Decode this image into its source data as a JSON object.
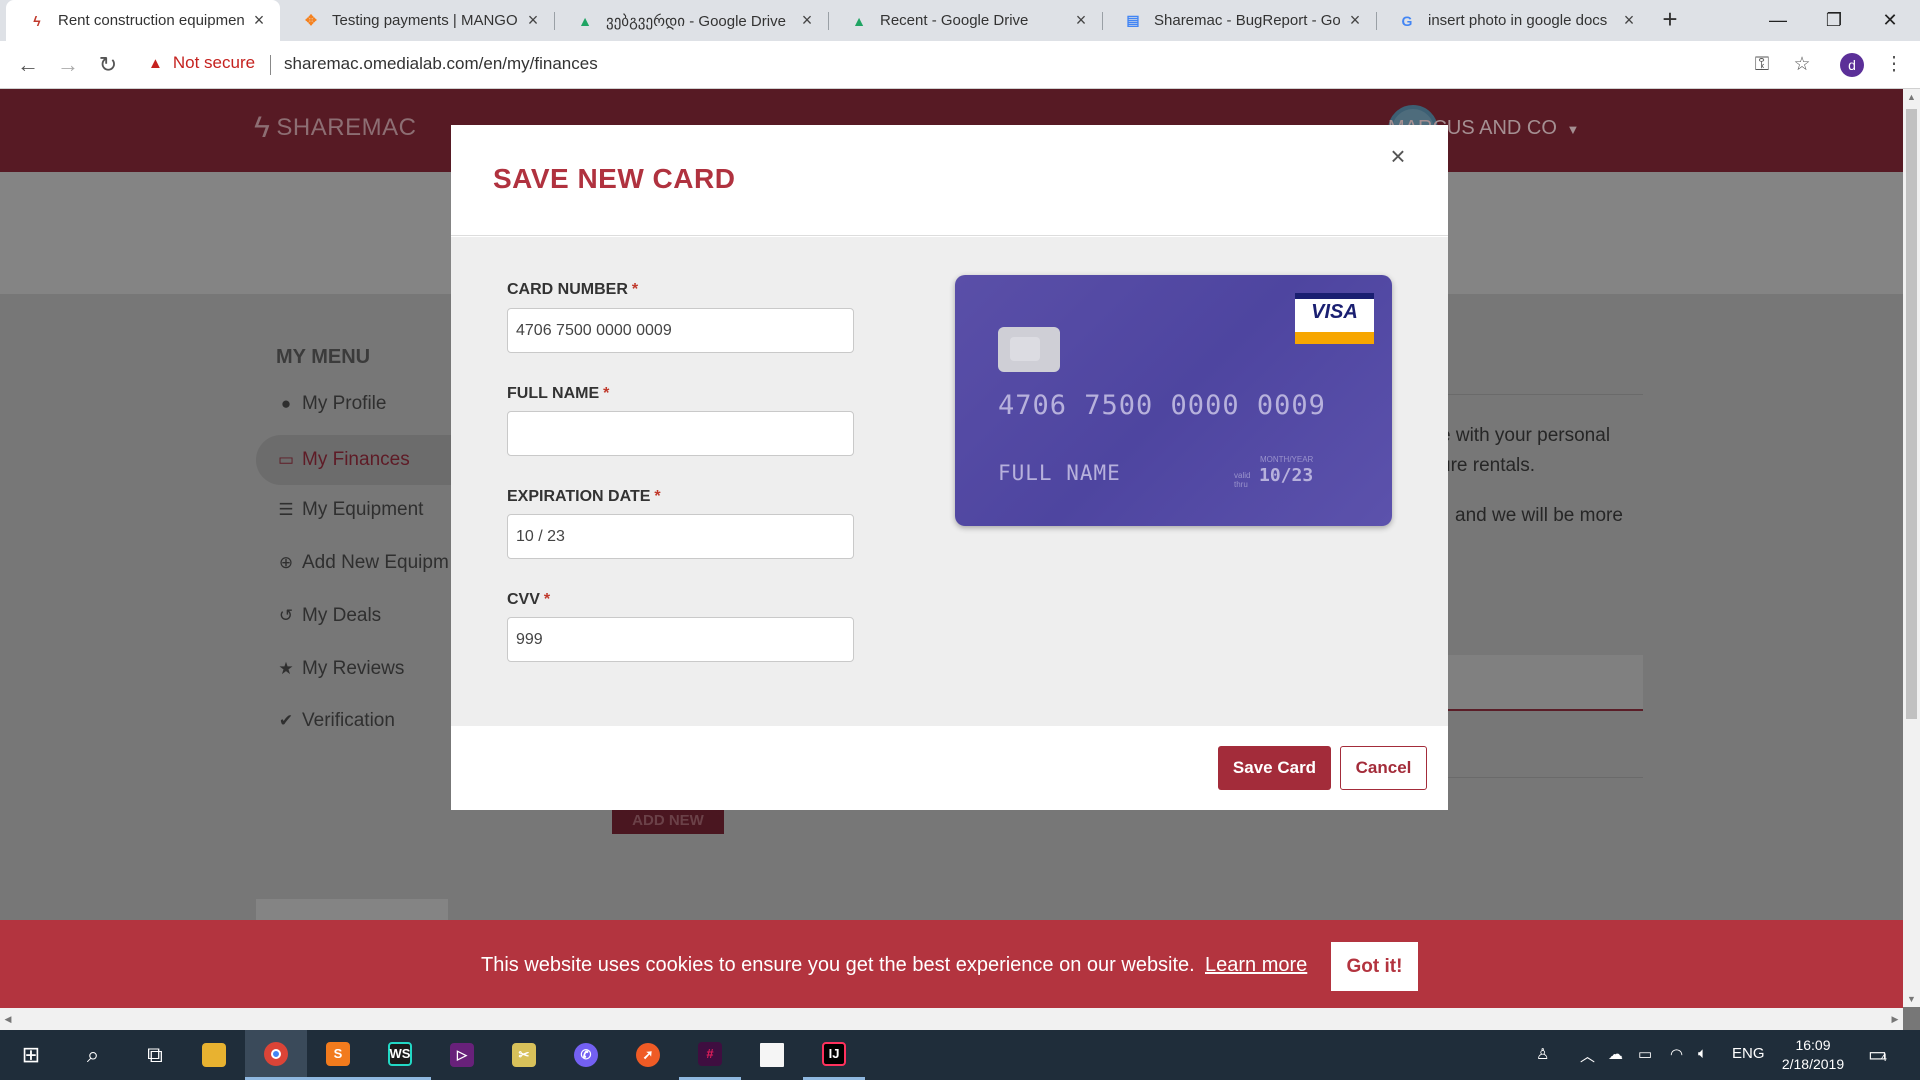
{
  "browser": {
    "tabs": [
      {
        "title": "Rent construction equipment",
        "favicon": "sharemac-bolt-icon"
      },
      {
        "title": "Testing payments | MANGOPAY",
        "favicon": "mangopay-icon"
      },
      {
        "title": "ვებგვერდი - Google Drive",
        "favicon": "google-drive-icon"
      },
      {
        "title": "Recent - Google Drive",
        "favicon": "google-drive-icon"
      },
      {
        "title": "Sharemac - BugReport - Google Docs",
        "favicon": "google-docs-icon"
      },
      {
        "title": "insert photo in google docs",
        "favicon": "google-icon"
      }
    ],
    "security_label": "Not secure",
    "url": "sharemac.omedialab.com/en/my/finances",
    "profile_initial": "d"
  },
  "site": {
    "logo_text": "SHAREMAC",
    "company_name": "MARCUS AND CO",
    "menu_title": "MY MENU",
    "menu_items": [
      {
        "label": "My Profile",
        "icon": "user-circle-icon"
      },
      {
        "label": "My Finances",
        "icon": "credit-card-icon"
      },
      {
        "label": "My Equipment",
        "icon": "list-icon"
      },
      {
        "label": "Add New Equipm",
        "icon": "plus-circle-icon"
      },
      {
        "label": "My Deals",
        "icon": "history-icon"
      },
      {
        "label": "My Reviews",
        "icon": "star-icon"
      },
      {
        "label": "Verification",
        "icon": "check-circle-icon"
      }
    ],
    "bg_text_1": "e with your personal",
    "bg_text_2": "ure rentals.",
    "bg_text_3": "and we will be more",
    "add_new_label": "ADD NEW"
  },
  "modal": {
    "title": "SAVE NEW CARD",
    "fields": {
      "card_number": {
        "label": "CARD NUMBER",
        "value": "4706 7500 0000 0009"
      },
      "full_name": {
        "label": "FULL NAME",
        "value": ""
      },
      "expiration": {
        "label": "EXPIRATION DATE",
        "value": "10 / 23"
      },
      "cvv": {
        "label": "CVV",
        "value": "999"
      }
    },
    "required_mark": "*",
    "card_preview": {
      "number": "4706 7500 0000 0009",
      "holder": "FULL NAME",
      "month_year_caption": "MONTH/YEAR",
      "valid_thru_caption": "valid thru",
      "expiry": "10/23",
      "brand": "VISA"
    },
    "save_label": "Save Card",
    "cancel_label": "Cancel"
  },
  "cookie": {
    "message": "This website uses cookies to ensure you get the best experience on our website.",
    "link_label": "Learn more",
    "button_label": "Got it!"
  },
  "taskbar": {
    "language": "ENG",
    "time": "16:09",
    "date": "2/18/2019",
    "notification_count": "4"
  },
  "colors": {
    "brand": "#a32c3a",
    "modal_title": "#b0323f",
    "card": "#5a4fa8",
    "cookie_banner": "#b3343f"
  }
}
